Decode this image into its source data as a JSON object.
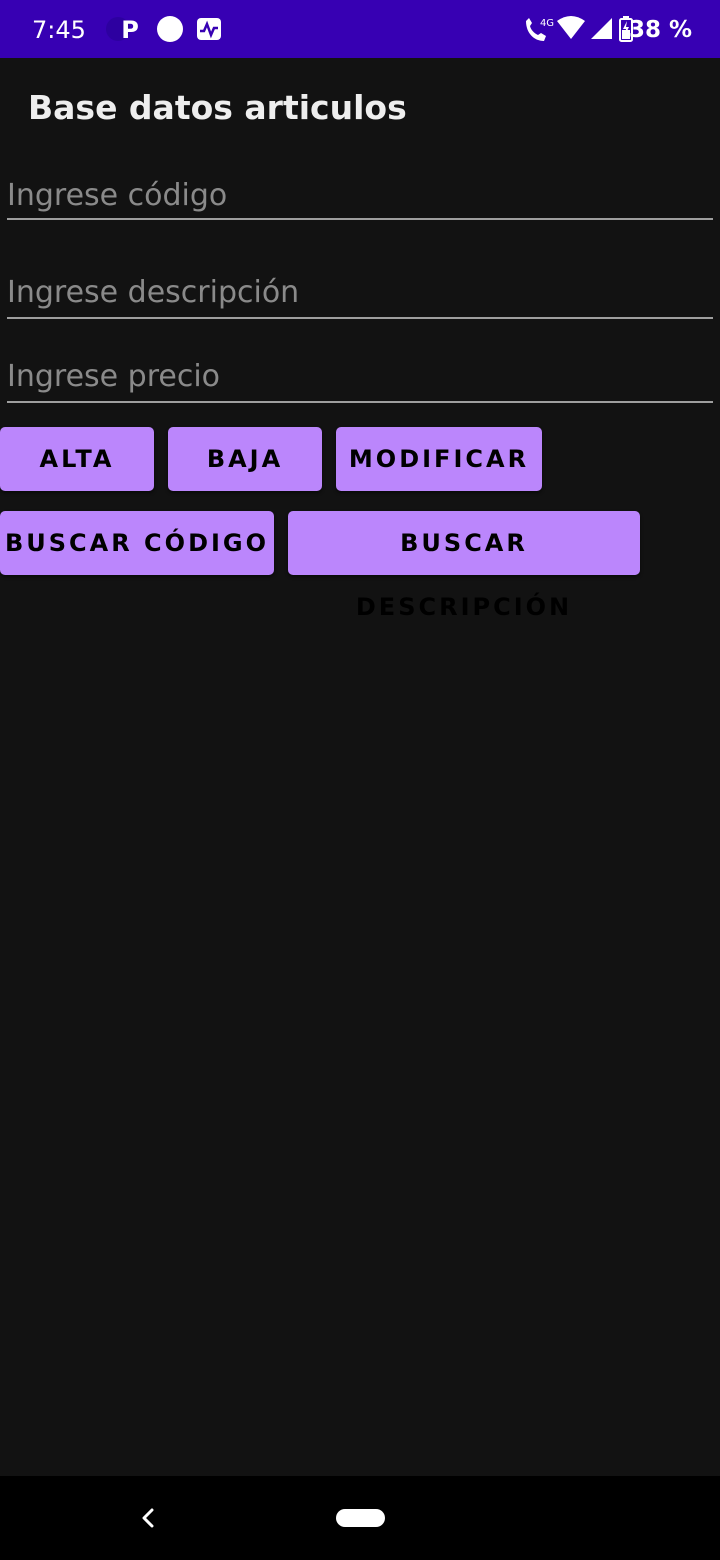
{
  "status_bar": {
    "time": "7:45",
    "battery_percent": "38 %",
    "network_type": "4G",
    "icons": [
      "parking-icon",
      "circle-notification-icon",
      "activity-icon",
      "wifi-calling-icon",
      "wifi-icon",
      "cell-signal-icon",
      "battery-icon"
    ]
  },
  "toolbar": {
    "title": "Base datos articulos"
  },
  "form": {
    "codigo_placeholder": "Ingrese código",
    "codigo_value": "",
    "descripcion_placeholder": "Ingrese descripción",
    "descripcion_value": "",
    "precio_placeholder": "Ingrese precio",
    "precio_value": ""
  },
  "buttons": {
    "alta": "ALTA",
    "baja": "BAJA",
    "modificar": "MODIFICAR",
    "buscar_codigo": "BUSCAR CÓDIGO",
    "buscar_descripcion": "BUSCAR DESCRIPCIÓN"
  },
  "colors": {
    "status_bar": "#3700b3",
    "background": "#121212",
    "button": "#bb86fc",
    "nav_bar": "#000000"
  },
  "nav_bar": {
    "icons": [
      "back-icon",
      "home-pill-icon"
    ]
  }
}
